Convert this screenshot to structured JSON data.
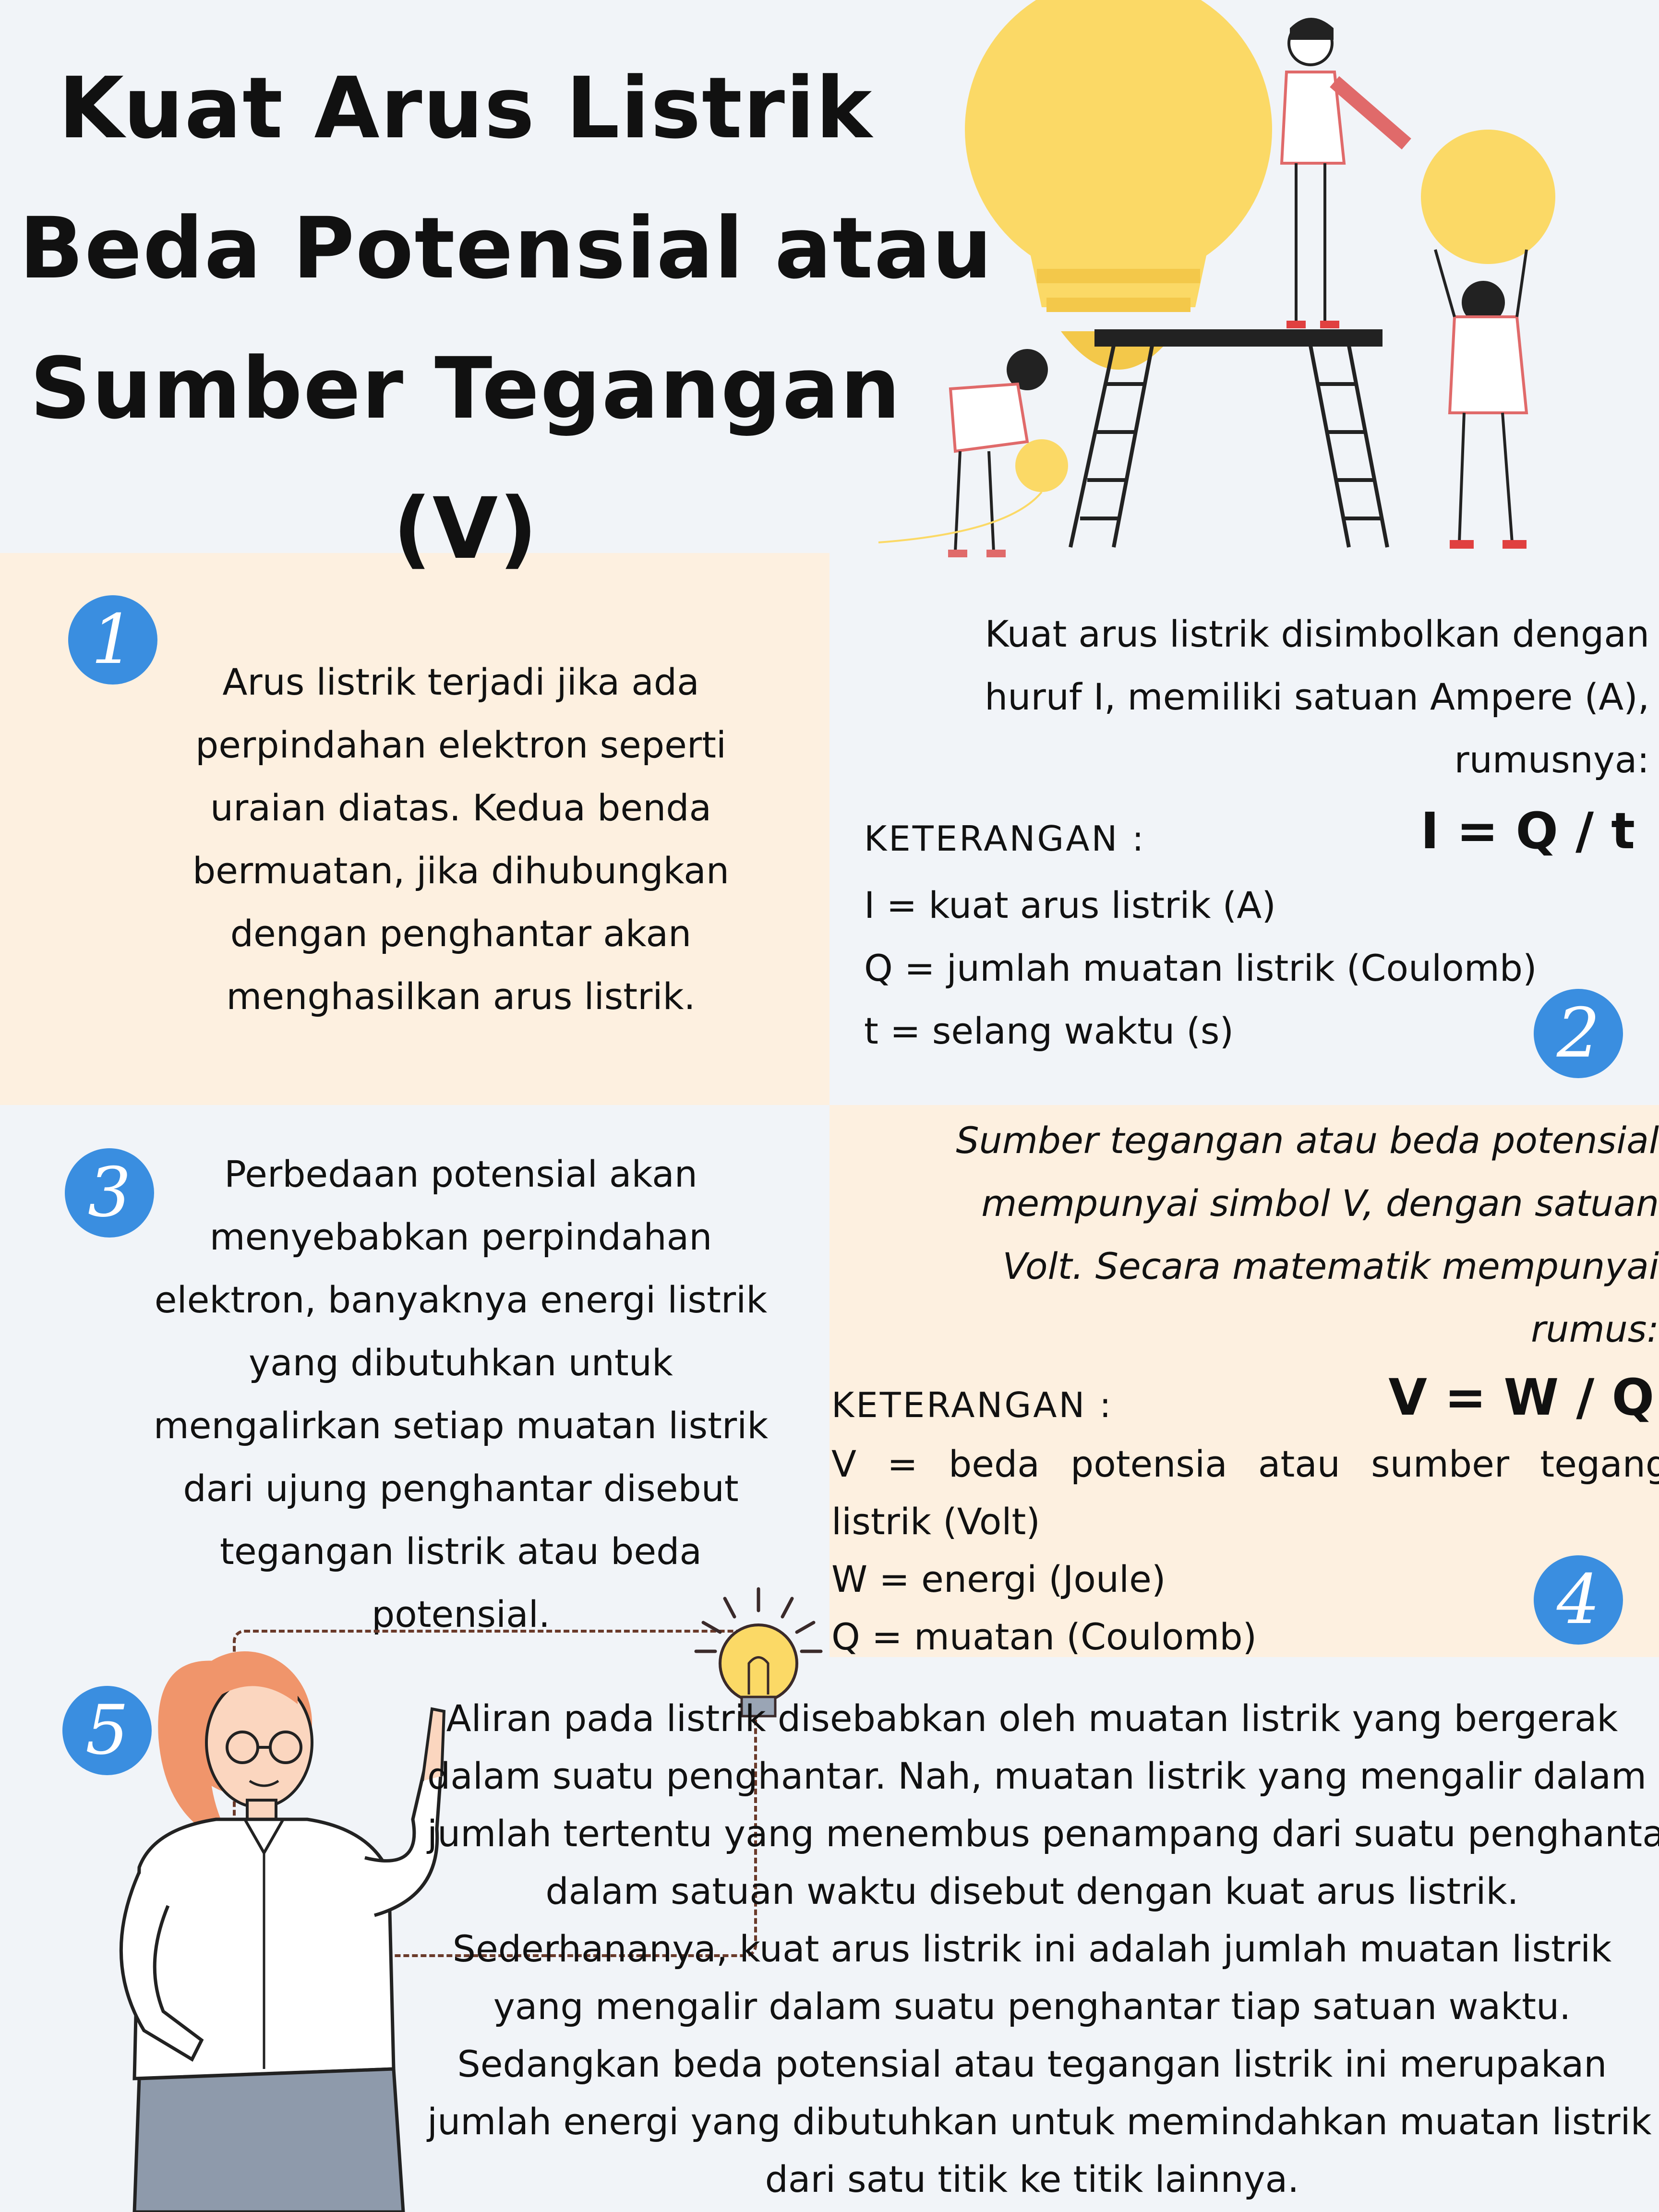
{
  "title": [
    "Kuat Arus Listrik",
    "Beda Potensial atau",
    "Sumber Tegangan",
    "(V)"
  ],
  "sections": {
    "s1": {
      "number": "1",
      "lines": [
        "Arus listrik terjadi jika ada",
        "perpindahan elektron seperti",
        "uraian diatas. Kedua benda",
        "bermuatan, jika dihubungkan",
        "dengan penghantar akan",
        "menghasilkan arus listrik."
      ]
    },
    "s2": {
      "number": "2",
      "intro": [
        "Kuat arus listrik disimbolkan dengan",
        "huruf I, memiliki satuan Ampere (A),",
        "rumusnya:"
      ],
      "formula": "I = Q / t",
      "keterangan": "KETERANGAN :",
      "legend": [
        "I = kuat arus listrik (A)",
        "Q = jumlah muatan listrik (Coulomb)",
        "t = selang waktu (s)"
      ]
    },
    "s3": {
      "number": "3",
      "lines": [
        "Perbedaan potensial akan",
        "menyebabkan perpindahan",
        "elektron, banyaknya energi listrik",
        "yang dibutuhkan untuk",
        "mengalirkan setiap muatan listrik",
        "dari ujung penghantar disebut",
        "tegangan listrik atau beda",
        "potensial."
      ]
    },
    "s4": {
      "number": "4",
      "intro": [
        "Sumber tegangan atau beda potensial",
        "mempunyai simbol V, dengan satuan",
        "Volt. Secara matematik mempunyai",
        "rumus:"
      ],
      "formula": "V = W / Q",
      "keterangan": "KETERANGAN :",
      "legend": [
        "V = beda potensia atau sumber tegangan",
        "listrik (Volt)",
        "W = energi (Joule)",
        "Q = muatan (Coulomb)"
      ]
    },
    "s5": {
      "number": "5",
      "lines": [
        "Aliran pada listrik disebabkan oleh muatan listrik yang bergerak",
        "dalam suatu penghantar. Nah, muatan listrik yang mengalir dalam",
        "jumlah tertentu yang menembus penampang dari suatu penghantar",
        "dalam satuan waktu disebut dengan kuat arus listrik.",
        "Sederhananya, kuat arus listrik ini adalah jumlah muatan listrik",
        "yang mengalir dalam suatu penghantar tiap satuan waktu.",
        "Sedangkan beda potensial atau tegangan listrik ini merupakan",
        "jumlah energi yang dibutuhkan untuk memindahkan muatan listrik",
        "dari satu titik ke titik lainnya."
      ]
    }
  },
  "colors": {
    "background": "#f1f4f8",
    "panel": "#fdf0e0",
    "badge": "#3a8ee0",
    "bulb": "#fbd966"
  },
  "illustrations": [
    "people-with-bulbs-illustration",
    "woman-pointing-illustration",
    "lightbulb-icon"
  ]
}
